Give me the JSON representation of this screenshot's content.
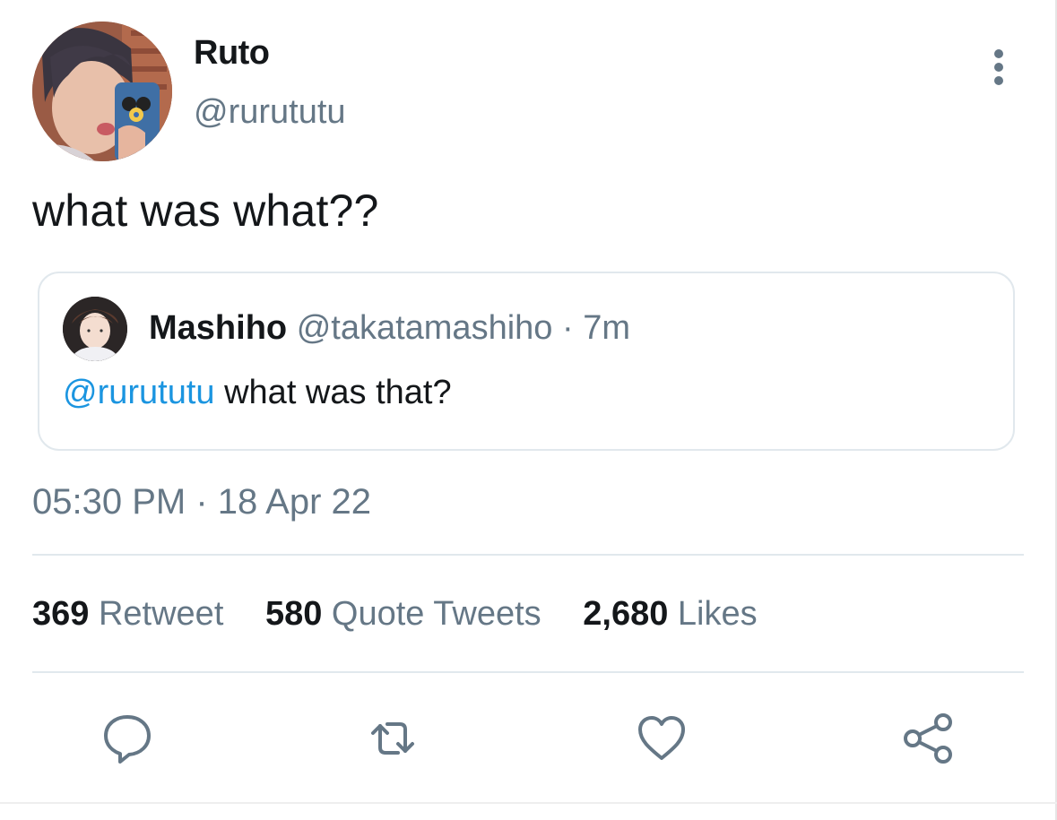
{
  "tweet": {
    "display_name": "Ruto",
    "handle": "@rurututu",
    "text": "what was what??",
    "timestamp": "05:30 PM · 18 Apr 22"
  },
  "quoted_tweet": {
    "display_name": "Mashiho",
    "handle": "@takatamashiho",
    "separator": "·",
    "time": "7m",
    "mention": "@rurututu",
    "text": "what was that?"
  },
  "stats": {
    "retweets": {
      "count": "369",
      "label": "Retweet"
    },
    "quotes": {
      "count": "580",
      "label": "Quote Tweets"
    },
    "likes": {
      "count": "2,680",
      "label": "Likes"
    }
  },
  "icons": {
    "more": "more-vertical-icon",
    "reply": "reply-icon",
    "retweet": "retweet-icon",
    "like": "heart-icon",
    "share": "share-icon"
  },
  "colors": {
    "text_primary": "#14171a",
    "text_secondary": "#657786",
    "link": "#1b95e0",
    "border": "#e1e8ed"
  }
}
